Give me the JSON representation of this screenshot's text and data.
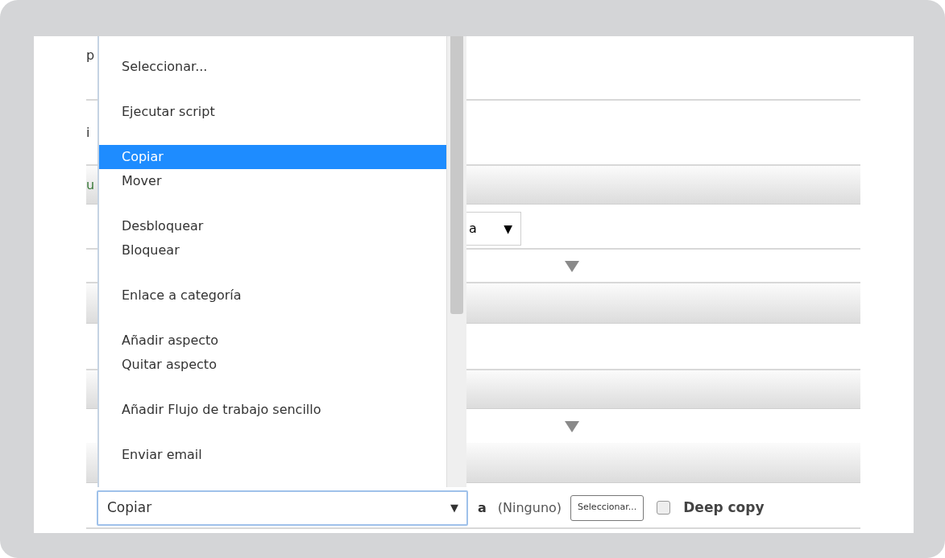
{
  "background_fragments": [
    {
      "text": "p"
    },
    {
      "text": "i"
    },
    {
      "text": "u"
    }
  ],
  "small_select": {
    "value": "a",
    "arrow": "▼"
  },
  "dropdown": {
    "option_groups": [
      {
        "options": [
          {
            "label": "Seleccionar...",
            "selected": false
          }
        ]
      },
      {
        "options": [
          {
            "label": "Ejecutar script",
            "selected": false
          }
        ]
      },
      {
        "options": [
          {
            "label": "Copiar",
            "selected": true
          },
          {
            "label": "Mover",
            "selected": false
          }
        ]
      },
      {
        "options": [
          {
            "label": "Desbloquear",
            "selected": false
          },
          {
            "label": "Bloquear",
            "selected": false
          }
        ]
      },
      {
        "options": [
          {
            "label": "Enlace a categoría",
            "selected": false
          }
        ]
      },
      {
        "options": [
          {
            "label": "Añadir aspecto",
            "selected": false
          },
          {
            "label": "Quitar aspecto",
            "selected": false
          }
        ]
      },
      {
        "options": [
          {
            "label": "Añadir Flujo de trabajo sencillo",
            "selected": false
          }
        ]
      },
      {
        "options": [
          {
            "label": "Enviar email",
            "selected": false
          }
        ]
      }
    ]
  },
  "action_row": {
    "select": {
      "value": "Copiar",
      "arrow": "▼"
    },
    "connector": "a",
    "target": "(Ninguno)",
    "button": "Seleccionar...",
    "deep_copy": {
      "label": "Deep copy",
      "checked": false
    }
  }
}
